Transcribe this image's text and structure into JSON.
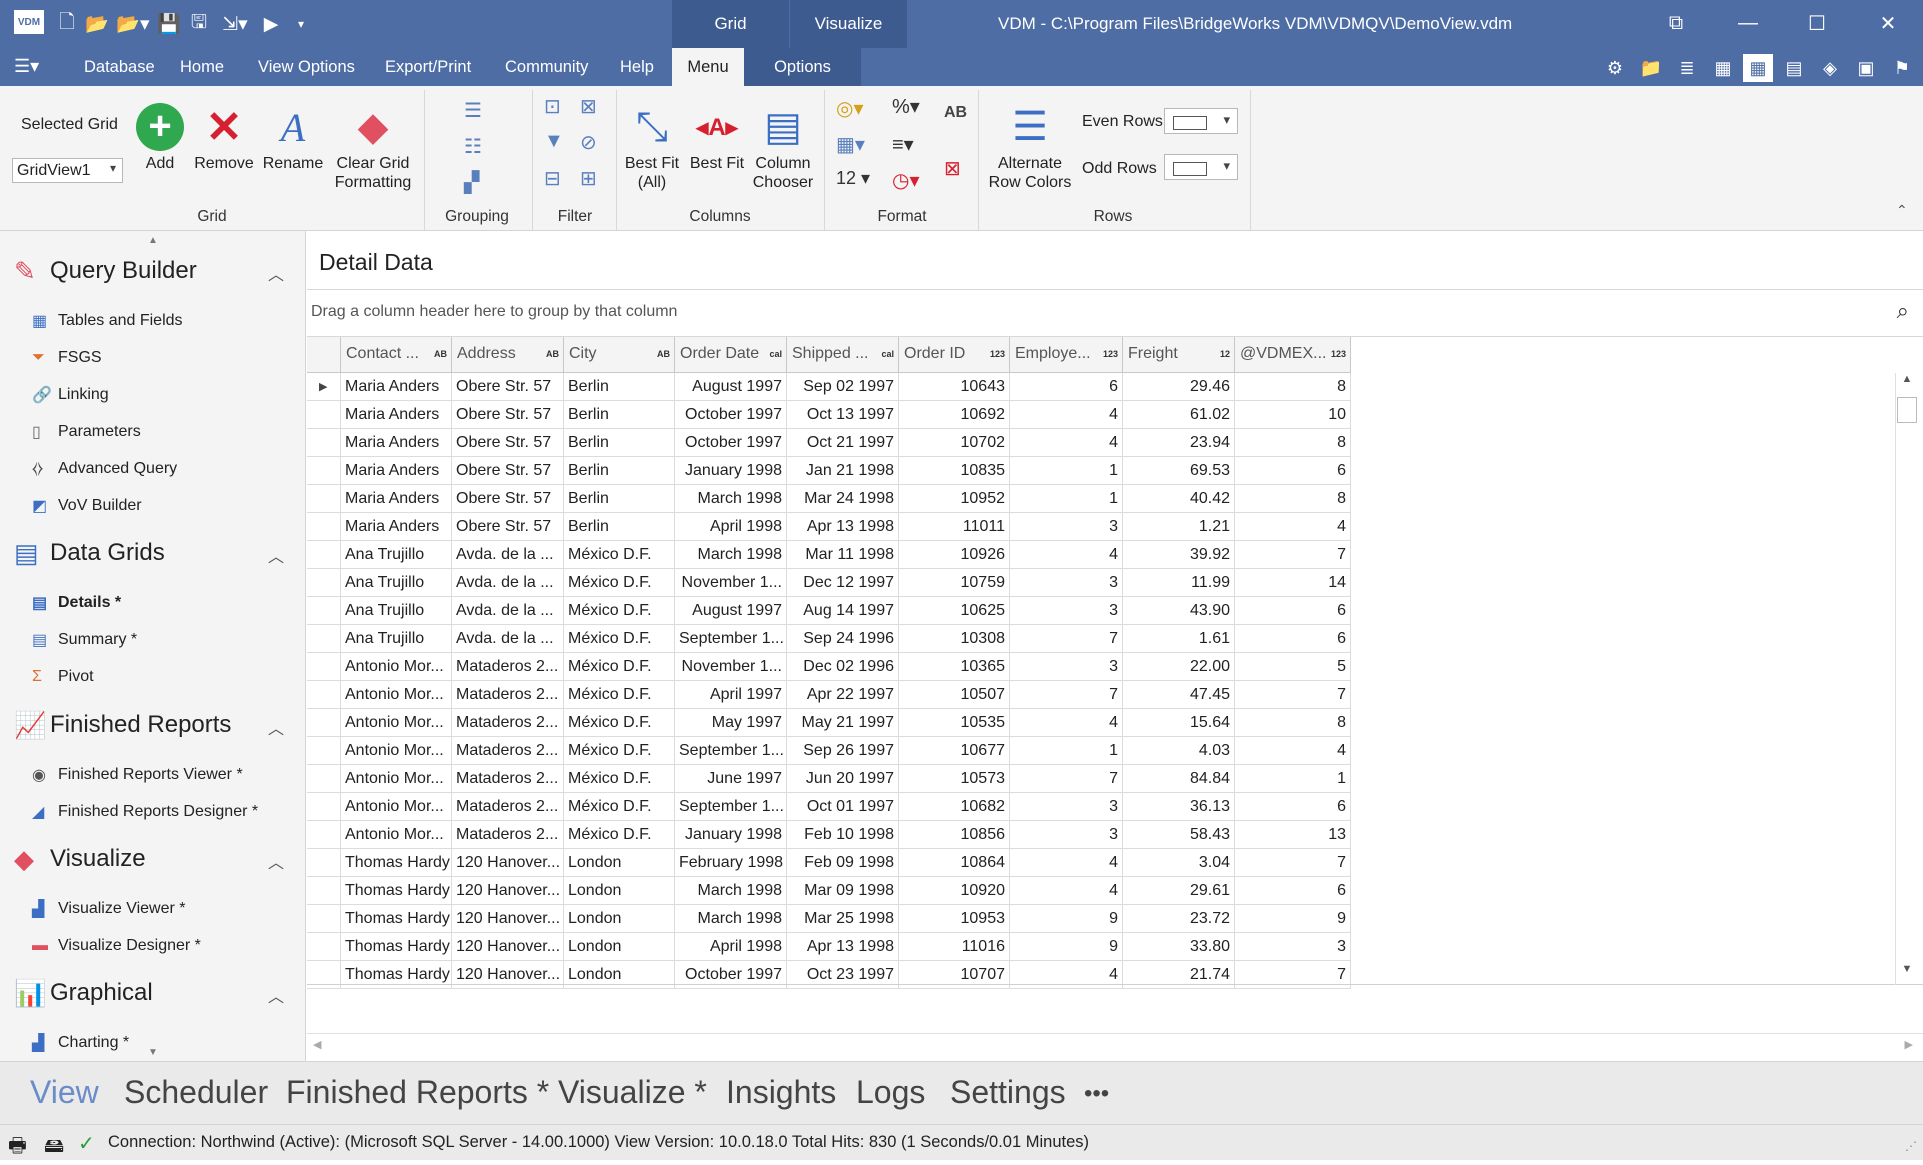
{
  "titlebar": {
    "app_icon": "VDM",
    "title": "VDM - C:\\Program Files\\BridgeWorks VDM\\VDMQV\\DemoView.vdm",
    "context_tabs": [
      "Grid",
      "Visualize"
    ],
    "window_buttons": [
      "restore-icon",
      "minimize-icon",
      "maximize-icon",
      "close-icon"
    ],
    "quick_access_icons": [
      "new-icon",
      "open-icon",
      "open-recent-icon",
      "save-icon",
      "save-all-icon",
      "export-icon",
      "run-icon",
      "customize-icon"
    ]
  },
  "menu": {
    "items": [
      "Database",
      "Home",
      "View Options",
      "Export/Print",
      "Community",
      "Help"
    ],
    "active": "Menu",
    "options": "Options",
    "right_icons": [
      "settings-doc-icon",
      "folder-icon",
      "list-icon",
      "grid-icon",
      "grid-selected-icon",
      "calendar-icon",
      "eraser-icon",
      "cpu-icon",
      "flag-icon"
    ]
  },
  "ribbon": {
    "selected_grid_label": "Selected Grid",
    "selected_grid_value": "GridView1",
    "grid_buttons": [
      "Add",
      "Remove",
      "Rename",
      "Clear Grid Formatting"
    ],
    "groups": [
      "Grid",
      "Grouping",
      "Filter",
      "Columns",
      "Format",
      "Rows"
    ],
    "column_buttons": [
      "Best Fit (All)",
      "Best Fit",
      "Column Chooser"
    ],
    "format_labels": [
      "%",
      "AB",
      "12"
    ],
    "rows_button": "Alternate Row Colors",
    "even_rows": "Even Rows",
    "odd_rows": "Odd Rows"
  },
  "sidebar": {
    "sections": [
      {
        "title": "Query Builder",
        "items": [
          "Tables and Fields",
          "FSGS",
          "Linking",
          "Parameters",
          "Advanced Query",
          "VoV Builder"
        ]
      },
      {
        "title": "Data Grids",
        "items": [
          "Details *",
          "Summary *",
          "Pivot"
        ]
      },
      {
        "title": "Finished Reports",
        "items": [
          "Finished Reports Viewer *",
          "Finished Reports Designer *"
        ]
      },
      {
        "title": "Visualize",
        "items": [
          "Visualize Viewer *",
          "Visualize Designer *"
        ]
      },
      {
        "title": "Graphical",
        "items": [
          "Charting *"
        ]
      }
    ]
  },
  "main": {
    "title": "Detail Data",
    "group_hint": "Drag a column header here to group by that column",
    "columns": [
      "Contact ...",
      "Address",
      "City",
      "Order Date",
      "Shipped ...",
      "Order ID",
      "Employe...",
      "Freight",
      "@VDMEX..."
    ],
    "column_tags": [
      "AB",
      "AB",
      "AB",
      "cal",
      "cal",
      "123",
      "123",
      "12",
      "123"
    ],
    "rows": [
      [
        "Maria Anders",
        "Obere Str. 57",
        "Berlin",
        "August 1997",
        "Sep 02 1997",
        "10643",
        "6",
        "29.46",
        "8"
      ],
      [
        "Maria Anders",
        "Obere Str. 57",
        "Berlin",
        "October 1997",
        "Oct 13 1997",
        "10692",
        "4",
        "61.02",
        "10"
      ],
      [
        "Maria Anders",
        "Obere Str. 57",
        "Berlin",
        "October 1997",
        "Oct 21 1997",
        "10702",
        "4",
        "23.94",
        "8"
      ],
      [
        "Maria Anders",
        "Obere Str. 57",
        "Berlin",
        "January 1998",
        "Jan 21 1998",
        "10835",
        "1",
        "69.53",
        "6"
      ],
      [
        "Maria Anders",
        "Obere Str. 57",
        "Berlin",
        "March 1998",
        "Mar 24 1998",
        "10952",
        "1",
        "40.42",
        "8"
      ],
      [
        "Maria Anders",
        "Obere Str. 57",
        "Berlin",
        "April 1998",
        "Apr 13 1998",
        "11011",
        "3",
        "1.21",
        "4"
      ],
      [
        "Ana Trujillo",
        "Avda. de la ...",
        "México D.F.",
        "March 1998",
        "Mar 11 1998",
        "10926",
        "4",
        "39.92",
        "7"
      ],
      [
        "Ana Trujillo",
        "Avda. de la ...",
        "México D.F.",
        "November 1...",
        "Dec 12 1997",
        "10759",
        "3",
        "11.99",
        "14"
      ],
      [
        "Ana Trujillo",
        "Avda. de la ...",
        "México D.F.",
        "August 1997",
        "Aug 14 1997",
        "10625",
        "3",
        "43.90",
        "6"
      ],
      [
        "Ana Trujillo",
        "Avda. de la ...",
        "México D.F.",
        "September 1...",
        "Sep 24 1996",
        "10308",
        "7",
        "1.61",
        "6"
      ],
      [
        "Antonio Mor...",
        "Mataderos  2...",
        "México D.F.",
        "November 1...",
        "Dec 02 1996",
        "10365",
        "3",
        "22.00",
        "5"
      ],
      [
        "Antonio Mor...",
        "Mataderos  2...",
        "México D.F.",
        "April 1997",
        "Apr 22 1997",
        "10507",
        "7",
        "47.45",
        "7"
      ],
      [
        "Antonio Mor...",
        "Mataderos  2...",
        "México D.F.",
        "May 1997",
        "May 21 1997",
        "10535",
        "4",
        "15.64",
        "8"
      ],
      [
        "Antonio Mor...",
        "Mataderos  2...",
        "México D.F.",
        "September 1...",
        "Sep 26 1997",
        "10677",
        "1",
        "4.03",
        "4"
      ],
      [
        "Antonio Mor...",
        "Mataderos  2...",
        "México D.F.",
        "June 1997",
        "Jun 20 1997",
        "10573",
        "7",
        "84.84",
        "1"
      ],
      [
        "Antonio Mor...",
        "Mataderos  2...",
        "México D.F.",
        "September 1...",
        "Oct 01 1997",
        "10682",
        "3",
        "36.13",
        "6"
      ],
      [
        "Antonio Mor...",
        "Mataderos  2...",
        "México D.F.",
        "January 1998",
        "Feb 10 1998",
        "10856",
        "3",
        "58.43",
        "13"
      ],
      [
        "Thomas Hardy",
        "120 Hanover...",
        "London",
        "February 1998",
        "Feb 09 1998",
        "10864",
        "4",
        "3.04",
        "7"
      ],
      [
        "Thomas Hardy",
        "120 Hanover...",
        "London",
        "March 1998",
        "Mar 09 1998",
        "10920",
        "4",
        "29.61",
        "6"
      ],
      [
        "Thomas Hardy",
        "120 Hanover...",
        "London",
        "March 1998",
        "Mar 25 1998",
        "10953",
        "9",
        "23.72",
        "9"
      ],
      [
        "Thomas Hardy",
        "120 Hanover...",
        "London",
        "April 1998",
        "Apr 13 1998",
        "11016",
        "9",
        "33.80",
        "3"
      ],
      [
        "Thomas Hardy",
        "120 Hanover...",
        "London",
        "October 1997",
        "Oct 23 1997",
        "10707",
        "4",
        "21.74",
        "7"
      ]
    ]
  },
  "bottom_nav": {
    "items": [
      "View",
      "Scheduler",
      "Finished Reports *",
      "Visualize *",
      "Insights",
      "Logs",
      "Settings",
      "•••"
    ],
    "active": "View"
  },
  "status": {
    "text": "Connection: Northwind (Active): (Microsoft SQL Server - 14.00.1000) View Version: 10.0.18.0  Total Hits: 830 (1 Seconds/0.01 Minutes)"
  },
  "colors": {
    "title_blue": "#4d6da4",
    "context_blue": "#3d5b8f",
    "active_nav": "#6a8cc8",
    "add_green": "#2fa84f",
    "remove_red": "#d6202f"
  }
}
